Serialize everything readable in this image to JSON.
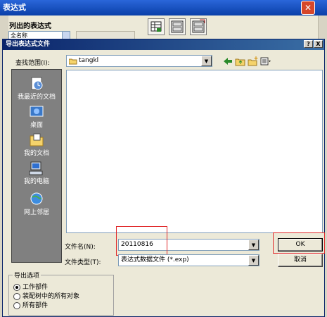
{
  "back_window": {
    "title": "表达式",
    "list_label": "列出的表达式",
    "list_combo_value": "全名称",
    "close_glyph": "✕"
  },
  "dialog": {
    "title": "导出表达式文件",
    "help_glyph": "?",
    "close_glyph": "X",
    "look_in_label": "查找范围(I):",
    "look_in_value": "tangkl",
    "places": [
      {
        "label": "我最近的文档",
        "icon": "recent-docs-icon"
      },
      {
        "label": "桌面",
        "icon": "desktop-icon"
      },
      {
        "label": "我的文档",
        "icon": "my-documents-icon"
      },
      {
        "label": "我的电脑",
        "icon": "my-computer-icon"
      },
      {
        "label": "网上邻居",
        "icon": "network-places-icon"
      }
    ],
    "file_name_label": "文件名(N):",
    "file_name_value": "20110816",
    "file_type_label": "文件类型(T):",
    "file_type_value": "表达式数据文件 (*.exp)",
    "ok_label": "OK",
    "cancel_label": "取消",
    "dropdown_glyph": "▼"
  },
  "export_options": {
    "title": "导出选项",
    "options": [
      {
        "label": "工作部件",
        "selected": true
      },
      {
        "label": "装配树中的所有对象",
        "selected": false
      },
      {
        "label": "所有部件",
        "selected": false
      }
    ]
  },
  "colors": {
    "highlight": "#e0282a",
    "title_bar": "#0a246a",
    "places_bg": "#808080"
  }
}
